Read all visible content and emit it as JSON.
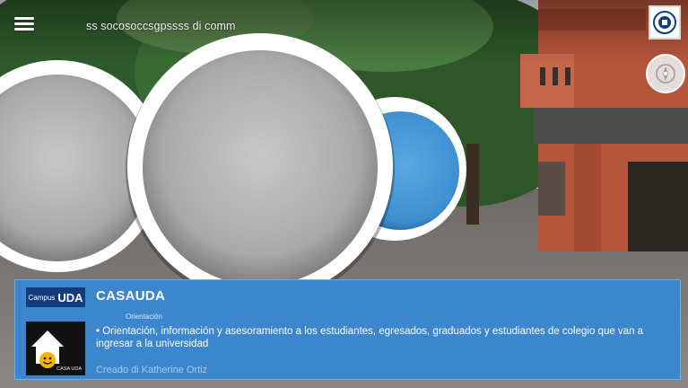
{
  "search": {
    "text": "ss socosoccsgpssss di comm"
  },
  "card": {
    "logo_label_small": "Campus",
    "logo_label_big": "UDA",
    "logo_sub": "CASA UDA",
    "title": "CASAUDA",
    "category": "Orientación",
    "description": "• Orientación, información y asesoramiento a los estudiantes, egresados, graduados y estudiantes de colegio que van a ingresar a la universidad",
    "author": "Creado di Katherine Ortiz"
  },
  "colors": {
    "card_background": "#3b86cc",
    "logo_label_background": "#123c7d",
    "marker_blue": "#3c8fd0"
  },
  "icons": {
    "menu": "menu-icon",
    "logo_badge": "university-seal-icon",
    "nav": "compass-icon",
    "card_logo": "house-smiley-icon"
  }
}
